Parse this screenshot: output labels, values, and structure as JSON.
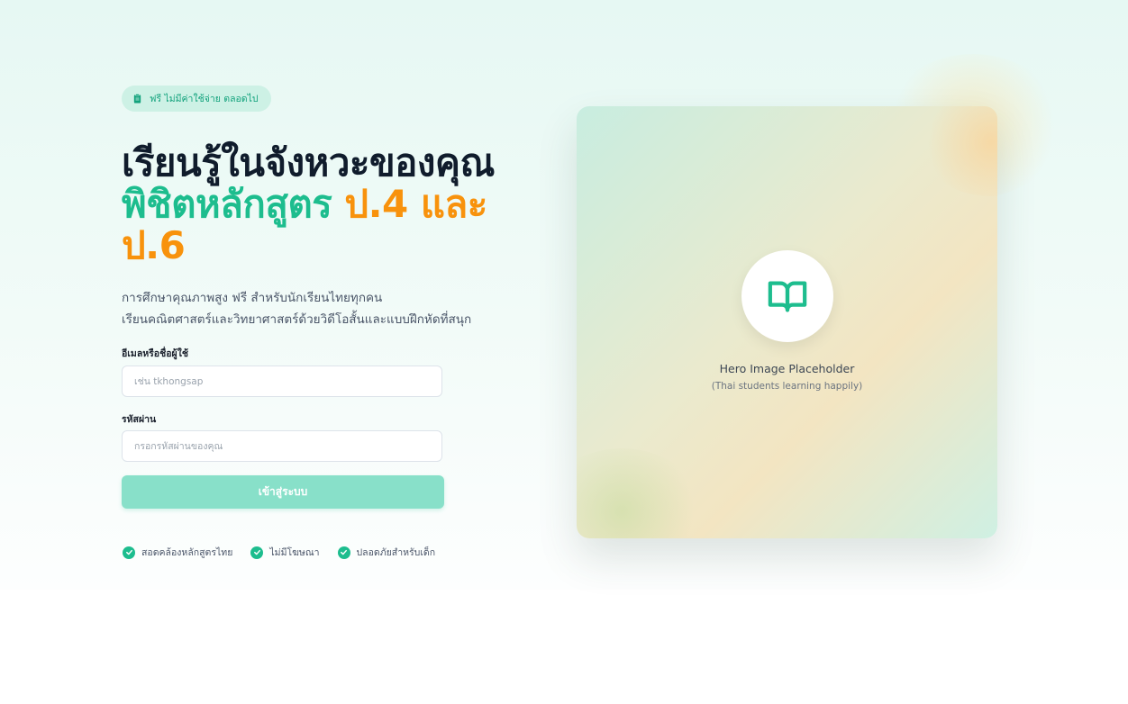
{
  "badge": {
    "icon": "clipboard-icon",
    "text": "ฟรี ไม่มีค่าใช้จ่าย ตลอดไป"
  },
  "headline": {
    "part1": "เรียนรู้ในจังหวะของคุณ",
    "part2": "พิชิตหลักสูตร",
    "part3": "ป.4 และ ป.6"
  },
  "description": {
    "line1": "การศึกษาคุณภาพสูง ฟรี สำหรับนักเรียนไทยทุกคน",
    "line2": "เรียนคณิตศาสตร์และวิทยาศาสตร์ด้วยวิดีโอสั้นและแบบฝึกหัดที่สนุก"
  },
  "form": {
    "username_label": "อีเมลหรือชื่อผู้ใช้",
    "username_value": "",
    "username_placeholder": "เช่น tkhongsap",
    "password_label": "รหัสผ่าน",
    "password_value": "",
    "password_placeholder": "กรอกรหัสผ่านของคุณ",
    "submit_label": "เข้าสู่ระบบ"
  },
  "features": [
    {
      "icon": "check-circle-icon",
      "label": "สอดคล้องหลักสูตรไทย"
    },
    {
      "icon": "check-circle-icon",
      "label": "ไม่มีโฆษณา"
    },
    {
      "icon": "check-circle-icon",
      "label": "ปลอดภัยสำหรับเด็ก"
    }
  ],
  "hero_image": {
    "icon": "open-book-icon",
    "title": "Hero Image Placeholder",
    "subtitle": "(Thai students learning happily)"
  },
  "colors": {
    "accent_green": "#1dbd8e",
    "accent_orange": "#f8920c",
    "heading": "#101c2c",
    "button_bg": "#88e0c9",
    "badge_bg": "#cdf1e5"
  }
}
